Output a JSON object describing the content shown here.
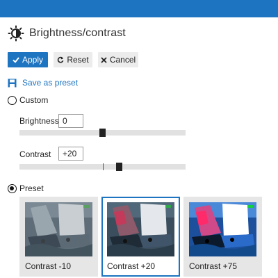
{
  "dialog": {
    "title": "Brightness/contrast",
    "icon": "brightness-icon"
  },
  "toolbar": {
    "apply_label": "Apply",
    "reset_label": "Reset",
    "cancel_label": "Cancel"
  },
  "save_preset_label": "Save as preset",
  "mode": {
    "custom_label": "Custom",
    "preset_label": "Preset",
    "selected": "Preset"
  },
  "custom": {
    "brightness_label": "Brightness",
    "brightness_value": "0",
    "contrast_label": "Contrast",
    "contrast_value": "+20"
  },
  "sliders": {
    "range": [
      -100,
      100
    ],
    "brightness": 0,
    "contrast": 20,
    "contrast_reference_tick": 0
  },
  "presets": [
    {
      "label": "Contrast -10",
      "selected": false
    },
    {
      "label": "Contrast +20",
      "selected": true
    },
    {
      "label": "Contrast +75",
      "selected": false
    }
  ],
  "colors": {
    "accent": "#1d74c0",
    "button_gray": "#ececec"
  }
}
